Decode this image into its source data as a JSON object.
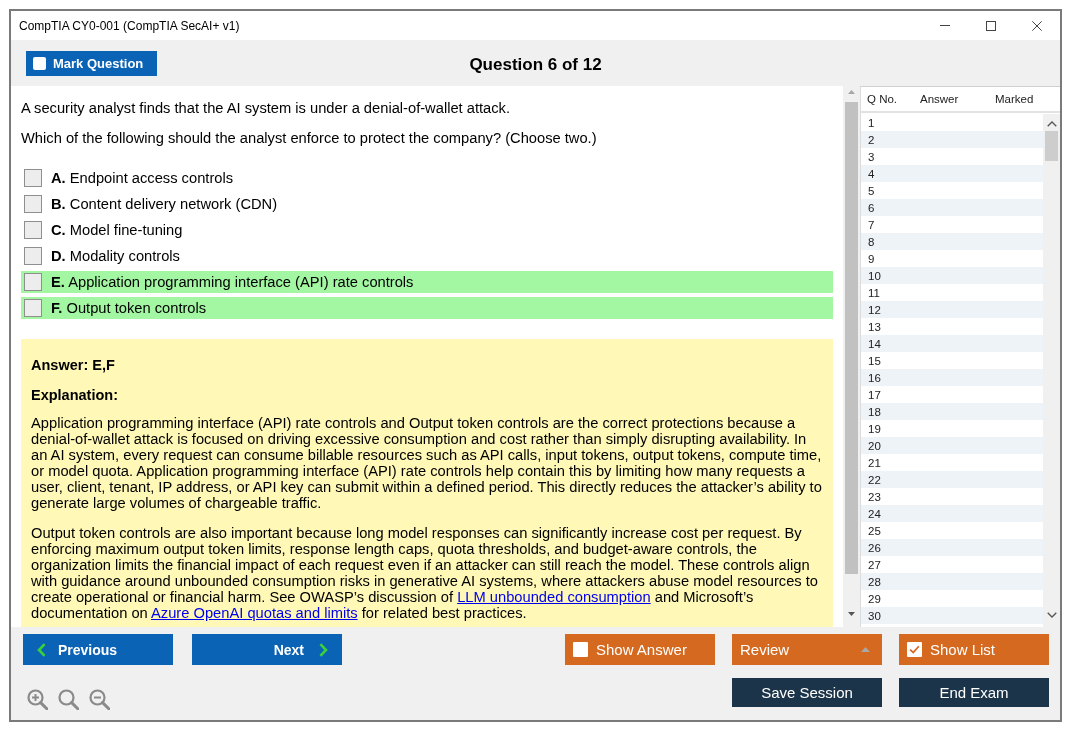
{
  "window": {
    "title": "CompTIA CY0-001 (CompTIA SecAI+ v1)"
  },
  "header": {
    "mark_question": {
      "label": "Mark Question",
      "checked": false
    },
    "title": "Question 6 of 12"
  },
  "question": {
    "stem": [
      "A security analyst finds that the AI system is under a denial-of-wallet attack.",
      "Which of the following should the analyst enforce to protect the company? (Choose two.)"
    ],
    "options": [
      {
        "text": "**A.** Endpoint access controls",
        "checked": false,
        "correct": false
      },
      {
        "text": "**B.** Content delivery network (CDN)",
        "checked": false,
        "correct": false
      },
      {
        "text": "**C.** Model fine-tuning",
        "checked": false,
        "correct": false
      },
      {
        "text": "**D.** Modality controls",
        "checked": false,
        "correct": false
      },
      {
        "text": "**E.** Application programming interface (API) rate controls",
        "checked": false,
        "correct": true
      },
      {
        "text": "**F.** Output token controls",
        "checked": false,
        "correct": true
      }
    ]
  },
  "explanation": {
    "answer": "Answer: E,F",
    "heading": "Explanation:",
    "paragraphs": [
      [
        {
          "kind": "text",
          "text": "Application programming interface (API) rate controls and Output token controls are the correct protections because a denial-of-wallet attack is focused on driving excessive consumption and cost rather than simply disrupting availability. In an AI system, every request can consume billable resources such as API calls, input tokens, output tokens, compute time, or model quota. Application programming interface (API) rate controls help contain this by limiting how many requests a user, client, tenant, IP address, or API key can submit within a defined period. This directly reduces the attacker’s ability to generate large volumes of chargeable traffic."
        }
      ],
      [
        {
          "kind": "text",
          "text": "Output token controls are also important because long model responses can significantly increase cost per request. By enforcing maximum output token limits, response length caps, quota thresholds, and budget-aware controls, the organization limits the financial impact of each request even if an attacker can still reach the model. These controls align with guidance around unbounded consumption risks in generative AI systems, where attackers abuse model resources to create operational or financial harm. See OWASP’s discussion of "
        },
        {
          "kind": "link",
          "text": "LLM unbounded consumption"
        },
        {
          "kind": "text",
          "text": " and Microsoft’s documentation on "
        },
        {
          "kind": "link",
          "text": "Azure OpenAI quotas and limits"
        },
        {
          "kind": "text",
          "text": " for related best practices."
        }
      ]
    ]
  },
  "question_list": {
    "columns": [
      "Q No.",
      "Answer",
      "Marked"
    ],
    "rows": [
      {
        "number": "1"
      },
      {
        "number": "2"
      },
      {
        "number": "3"
      },
      {
        "number": "4"
      },
      {
        "number": "5"
      },
      {
        "number": "6"
      },
      {
        "number": "7"
      },
      {
        "number": "8"
      },
      {
        "number": "9"
      },
      {
        "number": "10"
      },
      {
        "number": "11"
      },
      {
        "number": "12"
      },
      {
        "number": "13"
      },
      {
        "number": "14"
      },
      {
        "number": "15"
      },
      {
        "number": "16"
      },
      {
        "number": "17"
      },
      {
        "number": "18"
      },
      {
        "number": "19"
      },
      {
        "number": "20"
      },
      {
        "number": "21"
      },
      {
        "number": "22"
      },
      {
        "number": "23"
      },
      {
        "number": "24"
      },
      {
        "number": "25"
      },
      {
        "number": "26"
      },
      {
        "number": "27"
      },
      {
        "number": "28"
      },
      {
        "number": "29"
      },
      {
        "number": "30"
      }
    ]
  },
  "navigation": [
    {
      "kind": "previous",
      "label": "Previous"
    },
    {
      "kind": "next",
      "label": "Next"
    }
  ],
  "action_rows": [
    [
      {
        "kind": "toggle",
        "label": "Show Answer",
        "checked": false
      },
      {
        "kind": "dropdown",
        "label": "Review"
      },
      {
        "kind": "toggle",
        "label": "Show List",
        "checked": true
      }
    ],
    [
      {
        "kind": "command",
        "label": "Save Session"
      },
      {
        "kind": "command",
        "label": "End Exam"
      }
    ]
  ]
}
